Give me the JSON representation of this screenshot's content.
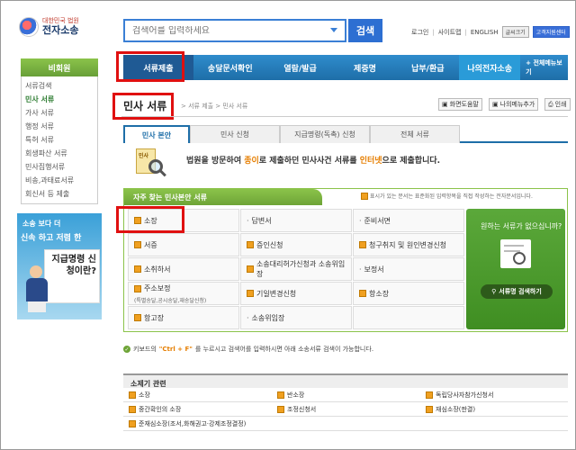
{
  "header": {
    "logo_sub": "대한민국 법원",
    "logo_main": "전자소송",
    "search_placeholder": "검색어를 입력하세요",
    "search_button": "검색",
    "links": [
      "로그인",
      "사이트맵",
      "ENGLISH"
    ],
    "btn_font": "글씨크기",
    "btn_support": "고객지원센터"
  },
  "nav": {
    "items": [
      "서류제출",
      "송달문서확인",
      "열람/발급",
      "제증명",
      "납부/환급",
      "나의전자소송"
    ],
    "all_menu": "+ 전체메뉴보기"
  },
  "sidebar": {
    "title": "비회원",
    "items": [
      "서류검색",
      "민사 서류",
      "가사 서류",
      "행정 서류",
      "특허 서류",
      "회생파산 서류",
      "민사집행서류",
      "비송,과태료서류",
      "회신서 등 제출"
    ]
  },
  "promo": {
    "line1": "소송 보다 더",
    "line2": "신속 하고 저렴 한",
    "card": "지급명령 신청이란?"
  },
  "page": {
    "title": "민사 서류",
    "crumb": "> 서류 제출 > 민사 서류",
    "util_help": "화면도움말",
    "util_menu": "나의메뉴추가",
    "util_print": "인쇄"
  },
  "tabs": [
    "민사 본안",
    "민사 신청",
    "지급명령(독촉) 신청",
    "전체 서류"
  ],
  "intro": {
    "icon_label": "민사",
    "t1": "법원을 방문하여 ",
    "h1": "종이",
    "t2": "로 제출하던 민사사건 서류를 ",
    "h2": "인터넷",
    "t3": "으로 제출합니다."
  },
  "note": "표시가 있는 문서는 표준화된 입력항목을 직접 작성하는 전자문서입니다.",
  "freq": {
    "title": "자주 찾는 민사본안 서류",
    "cells": [
      {
        "label": "소장",
        "icon": true
      },
      {
        "label": "답변서",
        "icon": false
      },
      {
        "label": "준비서면",
        "icon": false
      },
      {
        "label": "서증",
        "icon": true
      },
      {
        "label": "증인신청",
        "icon": true
      },
      {
        "label": "청구취지 및 원인변경신청",
        "icon": true
      },
      {
        "label": "소취하서",
        "icon": true
      },
      {
        "label": "소송대리허가신청과 소송위임장",
        "icon": true
      },
      {
        "label": "보정서",
        "icon": false
      },
      {
        "label": "주소보정",
        "sub": "(특별송달,공시송달,재송달신청)",
        "icon": true
      },
      {
        "label": "기일변경신청",
        "icon": true
      },
      {
        "label": "항소장",
        "icon": true
      },
      {
        "label": "항고장",
        "icon": true
      },
      {
        "label": "소송위임장",
        "icon": false
      },
      {
        "label": "",
        "icon": false
      }
    ],
    "side_title": "원하는 서류가 없으십니까?",
    "side_button": "서류명 검색하기"
  },
  "tip": {
    "t1": "키보드의 ",
    "key": "\"Ctrl + F\"",
    "t2": "를 누르시고 검색어를 입력하시면 아래 소송서류 검색이 가능합니다."
  },
  "related": {
    "title": "소제기 관련",
    "cells": [
      "소장",
      "반소장",
      "독립당사자참가신청서",
      "중간확인의 소장",
      "조정신청서",
      "재심소장(판결)",
      "준재심소장(조서,화해권고·강제조정결정)",
      "",
      ""
    ]
  }
}
